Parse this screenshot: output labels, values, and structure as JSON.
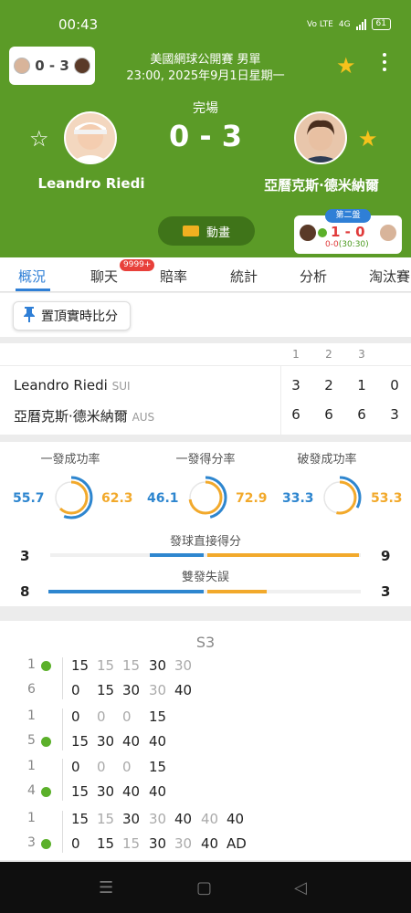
{
  "status": {
    "time": "00:43",
    "net1": "Vo LTE",
    "net2": "4G",
    "battery": "61"
  },
  "header": {
    "mini_score": "0 - 3",
    "competition": "美國網球公開賽 男單",
    "datetime": "23:00, 2025年9月1日星期一",
    "status": "完場",
    "score": "0 - 3",
    "player1": "Leandro Riedi",
    "player2": "亞曆克斯·德米納爾",
    "animation": "動畫",
    "set_tag": "第二盤",
    "set_score": "1 - 0",
    "set_sub_left": "0-0",
    "set_sub_right": "(30:30)"
  },
  "tabs": [
    "概況",
    "聊天",
    "賠率",
    "統計",
    "分析",
    "淘汰賽"
  ],
  "chat_badge": "9999+",
  "pin_label": "置頂實時比分",
  "score_table": {
    "headers": [
      "1",
      "2",
      "3"
    ],
    "rows": [
      {
        "name": "Leandro Riedi",
        "country": "SUI",
        "sets": [
          "3",
          "2",
          "1"
        ],
        "game": "0"
      },
      {
        "name": "亞曆克斯·德米納爾",
        "country": "AUS",
        "sets": [
          "6",
          "6",
          "6"
        ],
        "game": "3"
      }
    ]
  },
  "stats": {
    "rates": [
      {
        "label": "一發成功率",
        "left": "55.7",
        "right": "62.3"
      },
      {
        "label": "一發得分率",
        "left": "46.1",
        "right": "72.9"
      },
      {
        "label": "破發成功率",
        "left": "33.3",
        "right": "53.3"
      }
    ],
    "bars": [
      {
        "label": "發球直接得分",
        "left": "3",
        "right": "9",
        "left_val": 3,
        "right_val": 9
      },
      {
        "label": "雙發失誤",
        "left": "8",
        "right": "3",
        "left_val": 8,
        "right_val": 3
      }
    ]
  },
  "sets_detail": {
    "title": "S3",
    "groups": [
      {
        "top": "1",
        "bottom": "6",
        "row1": [
          "15",
          "15",
          "15",
          "30",
          "30"
        ],
        "row2": [
          "0",
          "15",
          "30",
          "30",
          "40"
        ]
      },
      {
        "top": "1",
        "bottom": "5",
        "row1": [
          "0",
          "0",
          "0",
          "15"
        ],
        "row2": [
          "15",
          "30",
          "40",
          "40"
        ]
      },
      {
        "top": "1",
        "bottom": "4",
        "row1": [
          "0",
          "0",
          "0",
          "15"
        ],
        "row2": [
          "15",
          "30",
          "40",
          "40"
        ]
      },
      {
        "top": "1",
        "bottom": "3",
        "row1": [
          "15",
          "15",
          "30",
          "30",
          "40",
          "40",
          "40"
        ],
        "row2": [
          "0",
          "15",
          "15",
          "30",
          "30",
          "40",
          "AD"
        ]
      }
    ]
  },
  "colors": {
    "header_green": "#5b9b27",
    "accent_blue": "#2f7fd6",
    "orange": "#f2a92b",
    "star": "#f6c21c"
  }
}
